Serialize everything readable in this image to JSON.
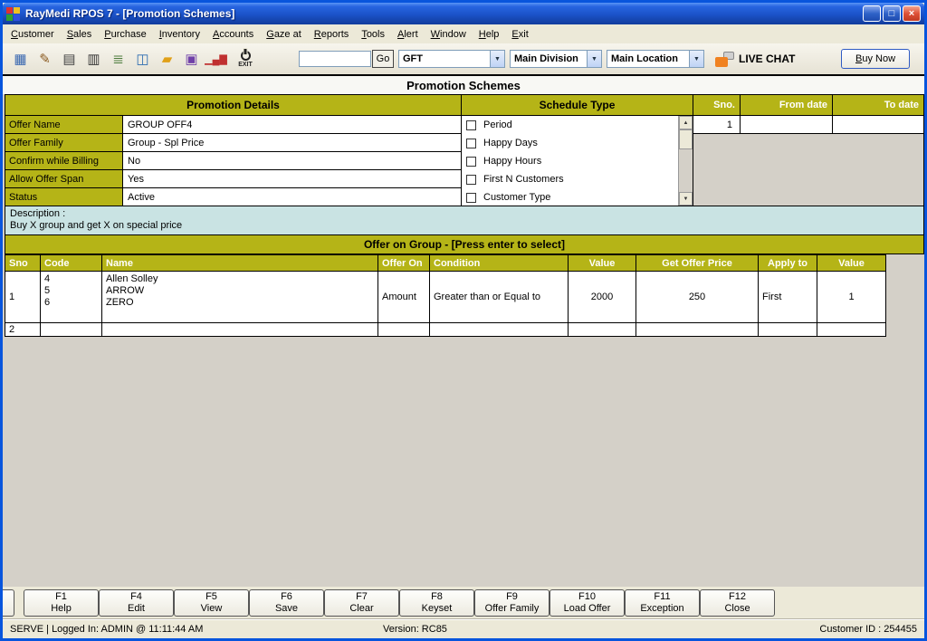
{
  "window": {
    "title": "RayMedi RPOS 7 - [Promotion Schemes]",
    "minimize_glyph": "_",
    "maximize_glyph": "□",
    "close_glyph": "×"
  },
  "menu": {
    "items": [
      "Customer",
      "Sales",
      "Purchase",
      "Inventory",
      "Accounts",
      "Gaze at",
      "Reports",
      "Tools",
      "Alert",
      "Window",
      "Help",
      "Exit"
    ]
  },
  "toolbar": {
    "icons": [
      {
        "name": "billing-icon",
        "glyph": "▦"
      },
      {
        "name": "save-document-icon",
        "glyph": "✎"
      },
      {
        "name": "printer-icon",
        "glyph": "▤"
      },
      {
        "name": "cash-register-icon",
        "glyph": "▥"
      },
      {
        "name": "document-icon",
        "glyph": "≣"
      },
      {
        "name": "ledger-icon",
        "glyph": "◫"
      },
      {
        "name": "folder-icon",
        "glyph": "▰"
      },
      {
        "name": "display-icon",
        "glyph": "▣"
      },
      {
        "name": "chart-icon",
        "glyph": "▁▄▇"
      }
    ],
    "exit_label": "EXIT",
    "search": {
      "value": "",
      "go_label": "Go"
    },
    "company_select": "GFT",
    "division_select": "Main Division",
    "location_select": "Main Location",
    "dropdown_arrow": "▼",
    "live_chat_label": "LIVE CHAT",
    "buy_now_label": "Buy Now"
  },
  "page_title": "Promotion Schemes",
  "details": {
    "header": "Promotion Details",
    "fields": [
      {
        "label": "Offer Name",
        "value": "GROUP OFF4"
      },
      {
        "label": "Offer Family",
        "value": "Group - Spl Price"
      },
      {
        "label": "Confirm while Billing",
        "value": "No"
      },
      {
        "label": "Allow Offer Span",
        "value": "Yes"
      },
      {
        "label": "Status",
        "value": "Active"
      }
    ]
  },
  "schedule": {
    "header": "Schedule Type",
    "options": [
      "Period",
      "Happy Days",
      "Happy Hours",
      "First N Customers",
      "Customer Type"
    ],
    "sno_header": "Sno.",
    "from_header": "From date",
    "to_header": "To date",
    "sno_value": "1",
    "scroll_up_glyph": "▲",
    "scroll_down_glyph": "▼"
  },
  "description": {
    "label": "Description :",
    "text": "Buy X group and get X on special price"
  },
  "offer": {
    "header": "Offer on Group - [Press enter to select]",
    "columns": [
      "Sno",
      "Code",
      "Name",
      "Offer On",
      "Condition",
      "Value",
      "Get Offer Price",
      "Apply to",
      "Value"
    ],
    "rows": [
      [
        "1",
        "4\n5\n6",
        "Allen Solley\nARROW\nZERO",
        "Amount",
        "Greater than or Equal to",
        "2000",
        "250",
        "First",
        "1"
      ],
      [
        "2",
        "",
        "",
        "",
        "",
        "",
        "",
        "",
        ""
      ]
    ]
  },
  "fkeys": [
    {
      "key": "F1",
      "label": "Help"
    },
    {
      "key": "F4",
      "label": "Edit"
    },
    {
      "key": "F5",
      "label": "View"
    },
    {
      "key": "F6",
      "label": "Save"
    },
    {
      "key": "F7",
      "label": "Clear"
    },
    {
      "key": "F8",
      "label": "Keyset"
    },
    {
      "key": "F9",
      "label": "Offer Family"
    },
    {
      "key": "F10",
      "label": "Load Offer"
    },
    {
      "key": "F11",
      "label": "Exception"
    },
    {
      "key": "F12",
      "label": "Close"
    }
  ],
  "status": {
    "left": "SERVE  |  Logged In: ADMIN  @ 11:11:44 AM",
    "center": "Version: RC85",
    "right": "Customer ID : 254455"
  },
  "colors": {
    "olive_header": "#B5B417",
    "description_bg": "#C9E3E3",
    "titlebar_blue": "#1B52C8",
    "frame_blue": "#0855DD",
    "content_gray": "#D4D0C8"
  }
}
